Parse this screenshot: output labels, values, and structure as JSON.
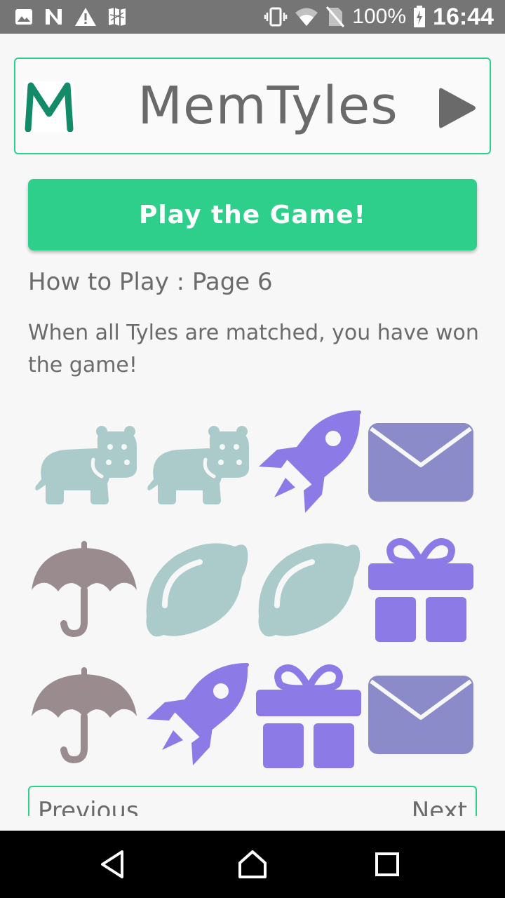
{
  "status_bar": {
    "battery": "100%",
    "time": "16:44",
    "icons": [
      "image-icon",
      "n-icon",
      "warning-icon",
      "map-icon",
      "vibrate-icon",
      "wifi-icon",
      "no-sim-icon",
      "battery-charging-icon"
    ]
  },
  "header": {
    "logo_letter": "M",
    "title": "MemTyles",
    "play_icon": "play-icon"
  },
  "play_button": {
    "label": "Play the Game!"
  },
  "how_to": {
    "title": "How to Play : Page 6",
    "text": "When all Tyles are matched, you have won the game!"
  },
  "tiles": [
    [
      "hippo",
      "hippo",
      "rocket",
      "envelope"
    ],
    [
      "umbrella",
      "lemon",
      "lemon",
      "gift"
    ],
    [
      "umbrella",
      "rocket",
      "gift",
      "envelope"
    ]
  ],
  "pager": {
    "previous": "Previous",
    "next": "Next"
  },
  "colors": {
    "accent": "#2ecf8b",
    "hippo": "#abcaca",
    "lemon": "#abcaca",
    "rocket": "#8c7be6",
    "gift": "#8c7be6",
    "envelope": "#8a8bc8",
    "umbrella": "#9a8b8e"
  },
  "nav_bar": {
    "icons": [
      "back-icon",
      "home-icon",
      "recent-apps-icon"
    ]
  }
}
